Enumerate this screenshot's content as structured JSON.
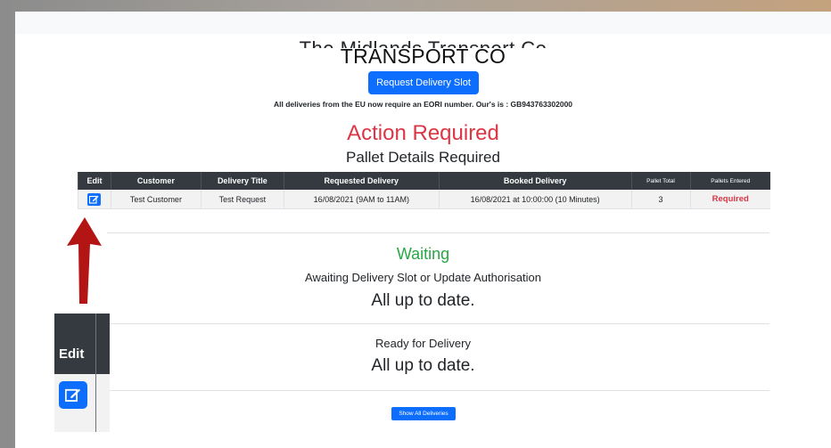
{
  "header": {
    "title_partial": "The Midlands Transport Co",
    "title": "TRANSPORT CO",
    "request_button": "Request Delivery Slot",
    "eori_notice": "All deliveries from the EU now require an EORI number. Our's is : GB943763302000"
  },
  "action_required": {
    "heading": "Action Required",
    "subheading": "Pallet Details Required",
    "columns": [
      "Edit",
      "Customer",
      "Delivery Title",
      "Requested Delivery",
      "Booked Delivery",
      "Pallet Total",
      "Pallets Entered"
    ],
    "rows": [
      {
        "customer": "Test Customer",
        "title": "Test Request",
        "requested": "16/08/2021 (9AM to 11AM)",
        "booked": "16/08/2021 at 10:00:00 (10 Minutes)",
        "pallet_total": "3",
        "pallets_entered": "Required"
      }
    ]
  },
  "waiting": {
    "heading": "Waiting",
    "subheading": "Awaiting Delivery Slot or Update Authorisation",
    "status": "All up to date."
  },
  "ready": {
    "heading": "Ready for Delivery",
    "status": "All up to date."
  },
  "footer": {
    "show_all_button": "Show All Deliveries"
  },
  "inset": {
    "edit_label": "Edit"
  },
  "icons": {
    "edit": "edit-pencil-square-icon",
    "arrow": "up-arrow-annotation"
  },
  "colors": {
    "primary": "#0d6efd",
    "danger": "#dc3545",
    "success": "#28a745",
    "table_header": "#343a40",
    "arrow": "#b31515"
  }
}
